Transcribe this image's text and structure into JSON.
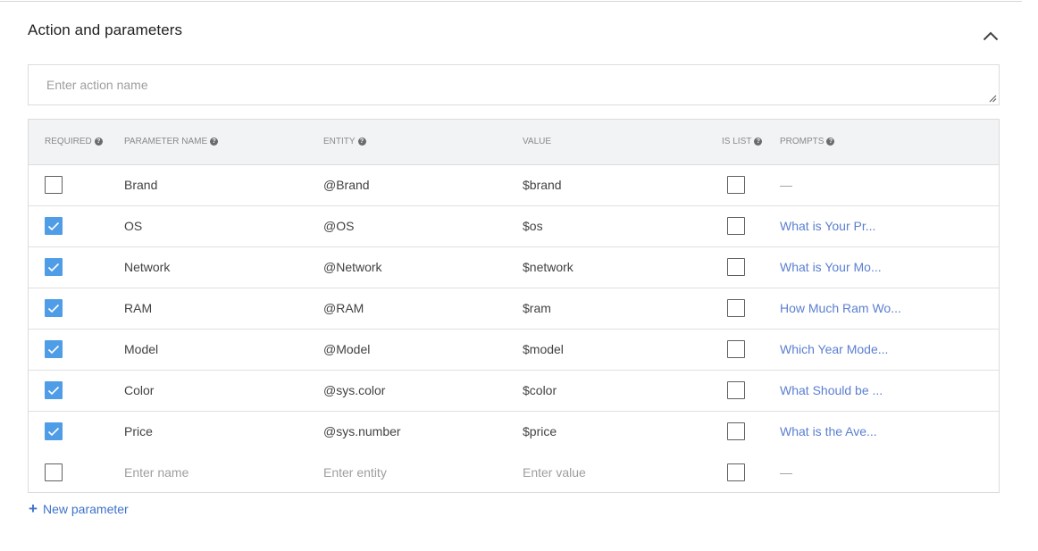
{
  "section": {
    "title": "Action and parameters"
  },
  "action_input": {
    "placeholder": "Enter action name",
    "value": ""
  },
  "table": {
    "headers": {
      "required": "REQUIRED",
      "parameter_name": "PARAMETER NAME",
      "entity": "ENTITY",
      "value": "VALUE",
      "is_list": "IS LIST",
      "prompts": "PROMPTS"
    },
    "rows": [
      {
        "required": false,
        "name": "Brand",
        "entity": "@Brand",
        "value": "$brand",
        "is_list": false,
        "prompt": "—"
      },
      {
        "required": true,
        "name": "OS",
        "entity": "@OS",
        "value": "$os",
        "is_list": false,
        "prompt": "What is Your Pr..."
      },
      {
        "required": true,
        "name": "Network",
        "entity": "@Network",
        "value": "$network",
        "is_list": false,
        "prompt": "What is Your Mo..."
      },
      {
        "required": true,
        "name": "RAM",
        "entity": "@RAM",
        "value": "$ram",
        "is_list": false,
        "prompt": "How Much Ram Wo..."
      },
      {
        "required": true,
        "name": "Model",
        "entity": "@Model",
        "value": "$model",
        "is_list": false,
        "prompt": "Which Year Mode..."
      },
      {
        "required": true,
        "name": "Color",
        "entity": "@sys.color",
        "value": "$color",
        "is_list": false,
        "prompt": "What Should be ..."
      },
      {
        "required": true,
        "name": "Price",
        "entity": "@sys.number",
        "value": "$price",
        "is_list": false,
        "prompt": "What is the Ave..."
      }
    ],
    "empty_row": {
      "required": false,
      "name_placeholder": "Enter name",
      "entity_placeholder": "Enter entity",
      "value_placeholder": "Enter value",
      "is_list": false,
      "prompt": "—"
    }
  },
  "new_parameter": {
    "label": "New parameter"
  },
  "colors": {
    "checkbox_checked": "#4f9de6",
    "prompt_link": "#5b7fd1",
    "new_parameter_link": "#3f73c9",
    "header_bg": "#f1f3f4"
  },
  "icons": {
    "collapse": "chevron-up-icon",
    "help": "help-circle-icon",
    "check": "check-icon",
    "add": "plus-icon"
  }
}
